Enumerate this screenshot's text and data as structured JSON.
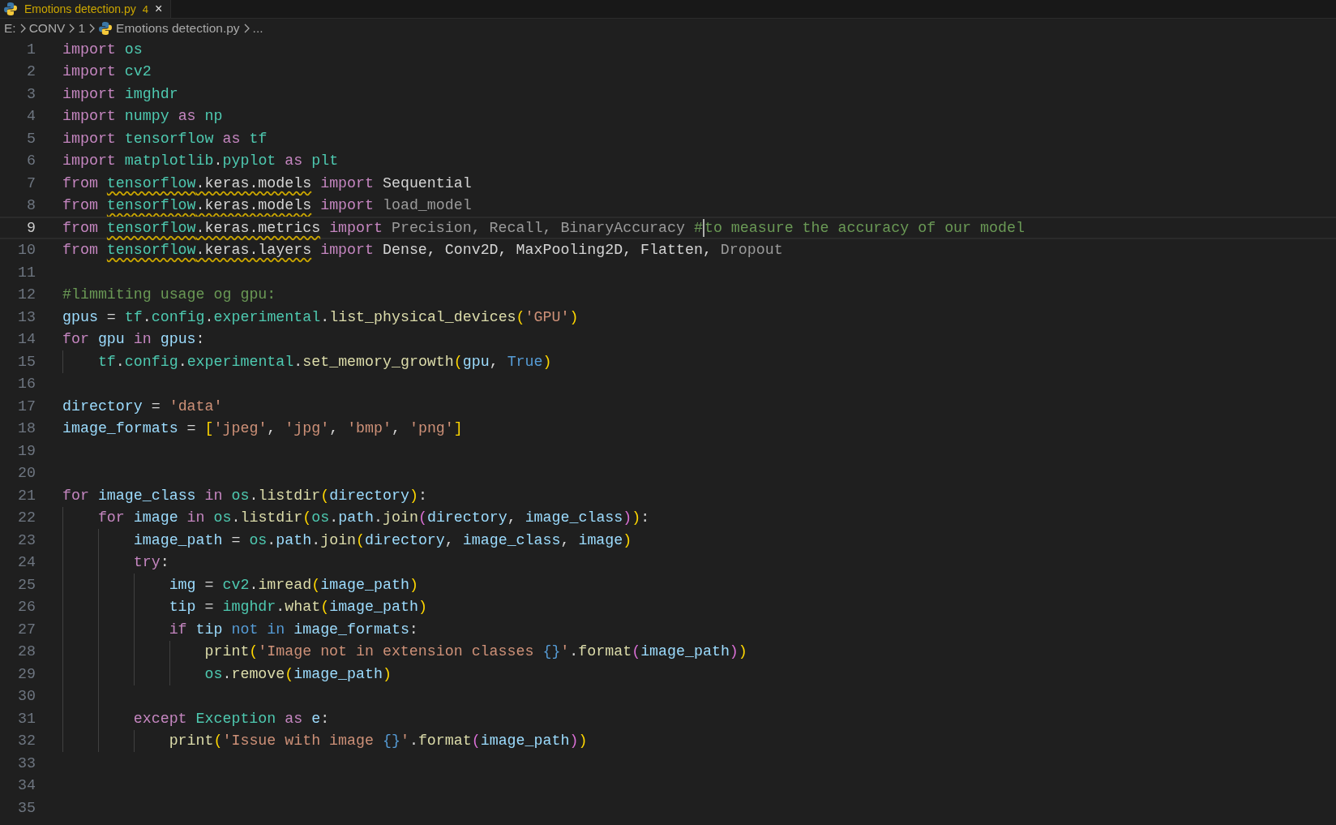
{
  "tab": {
    "title": "Emotions detection.py",
    "problems": "4",
    "close": "×"
  },
  "breadcrumb": [
    "E:",
    "CONV",
    "1",
    "Emotions detection.py",
    "..."
  ],
  "lines": [
    {
      "n": "1",
      "current": false,
      "tokens": [
        {
          "t": "import",
          "kind": "kw"
        },
        {
          "t": " os",
          "kind": "mod"
        }
      ]
    },
    {
      "n": "2",
      "current": false,
      "tokens": [
        {
          "t": "import",
          "kind": "kw"
        },
        {
          "t": " cv2",
          "kind": "mod"
        }
      ]
    },
    {
      "n": "3",
      "current": false,
      "tokens": [
        {
          "t": "import",
          "kind": "kw"
        },
        {
          "t": " imghdr",
          "kind": "mod"
        }
      ]
    },
    {
      "n": "4",
      "current": false,
      "tokens": [
        {
          "t": "import",
          "kind": "kw"
        },
        {
          "t": " numpy",
          "kind": "mod"
        },
        {
          "t": " as",
          "kind": "kw"
        },
        {
          "t": " np",
          "kind": "mod"
        }
      ]
    },
    {
      "n": "5",
      "current": false,
      "tokens": [
        {
          "t": "import",
          "kind": "kw"
        },
        {
          "t": " tensorflow",
          "kind": "mod"
        },
        {
          "t": " as",
          "kind": "kw"
        },
        {
          "t": " tf",
          "kind": "mod"
        }
      ]
    },
    {
      "n": "6",
      "current": false,
      "tokens": [
        {
          "t": "import",
          "kind": "kw"
        },
        {
          "t": " matplotlib",
          "kind": "mod"
        },
        {
          "t": ".",
          "kind": "plain"
        },
        {
          "t": "pyplot",
          "kind": "mod"
        },
        {
          "t": " as",
          "kind": "kw"
        },
        {
          "t": " plt",
          "kind": "mod"
        }
      ]
    },
    {
      "n": "7",
      "current": false,
      "tokens": [
        {
          "t": "from ",
          "kind": "kw"
        },
        {
          "t": "tensorflow",
          "kind": "mod",
          "warn": true
        },
        {
          "t": ".keras.models",
          "kind": "plain",
          "warn": true
        },
        {
          "t": " import",
          "kind": "kw"
        },
        {
          "t": " Sequential",
          "kind": "plain"
        }
      ]
    },
    {
      "n": "8",
      "current": false,
      "tokens": [
        {
          "t": "from ",
          "kind": "kw"
        },
        {
          "t": "tensorflow",
          "kind": "mod",
          "warn": true
        },
        {
          "t": ".keras.models",
          "kind": "plain",
          "warn": true
        },
        {
          "t": " import",
          "kind": "kw"
        },
        {
          "t": " load_model",
          "kind": "dim"
        }
      ]
    },
    {
      "n": "9",
      "current": true,
      "tokens": [
        {
          "t": "from ",
          "kind": "kw"
        },
        {
          "t": "tensorflow",
          "kind": "mod",
          "warn": true
        },
        {
          "t": ".keras.metrics",
          "kind": "plain",
          "warn": true
        },
        {
          "t": " import",
          "kind": "kw"
        },
        {
          "t": " Precision, Recall, BinaryAccuracy ",
          "kind": "dim"
        },
        {
          "t": "#",
          "kind": "cmt",
          "caret": true
        },
        {
          "t": "to measure the accuracy of our model",
          "kind": "cmt"
        }
      ]
    },
    {
      "n": "10",
      "current": false,
      "tokens": [
        {
          "t": "from ",
          "kind": "kw"
        },
        {
          "t": "tensorflow",
          "kind": "mod",
          "warn": true
        },
        {
          "t": ".keras.layers",
          "kind": "plain",
          "warn": true
        },
        {
          "t": " import",
          "kind": "kw"
        },
        {
          "t": " Dense, Conv2D, MaxPooling2D, Flatten,",
          "kind": "plain"
        },
        {
          "t": " Dropout",
          "kind": "dim"
        }
      ]
    },
    {
      "n": "11",
      "current": false
    },
    {
      "n": "12",
      "current": false,
      "tokens": [
        {
          "t": "#limmiting usage og gpu:",
          "kind": "cmt"
        }
      ]
    },
    {
      "n": "13",
      "current": false,
      "tokens": [
        {
          "t": "gpus",
          "kind": "var"
        },
        {
          "t": " = ",
          "kind": "plain"
        },
        {
          "t": "tf",
          "kind": "mod"
        },
        {
          "t": ".",
          "kind": "plain"
        },
        {
          "t": "config",
          "kind": "mod"
        },
        {
          "t": ".",
          "kind": "plain"
        },
        {
          "t": "experimental",
          "kind": "mod"
        },
        {
          "t": ".",
          "kind": "plain"
        },
        {
          "t": "list_physical_devices",
          "kind": "fn"
        },
        {
          "t": "(",
          "kind": "b1"
        },
        {
          "t": "'GPU'",
          "kind": "str"
        },
        {
          "t": ")",
          "kind": "b1"
        }
      ]
    },
    {
      "n": "14",
      "current": false,
      "tokens": [
        {
          "t": "for",
          "kind": "kw"
        },
        {
          "t": " gpu",
          "kind": "var"
        },
        {
          "t": " in",
          "kind": "kw"
        },
        {
          "t": " gpus",
          "kind": "var"
        },
        {
          "t": ":",
          "kind": "plain"
        }
      ]
    },
    {
      "n": "15",
      "current": false,
      "tokens": [
        {
          "t": "    tf",
          "kind": "mod"
        },
        {
          "t": ".",
          "kind": "plain"
        },
        {
          "t": "config",
          "kind": "mod"
        },
        {
          "t": ".",
          "kind": "plain"
        },
        {
          "t": "experimental",
          "kind": "mod"
        },
        {
          "t": ".",
          "kind": "plain"
        },
        {
          "t": "set_memory_growth",
          "kind": "fn"
        },
        {
          "t": "(",
          "kind": "b1"
        },
        {
          "t": "gpu",
          "kind": "var"
        },
        {
          "t": ", ",
          "kind": "plain"
        },
        {
          "t": "True",
          "kind": "const"
        },
        {
          "t": ")",
          "kind": "b1"
        }
      ]
    },
    {
      "n": "16",
      "current": false
    },
    {
      "n": "17",
      "current": false,
      "tokens": [
        {
          "t": "directory",
          "kind": "var"
        },
        {
          "t": " = ",
          "kind": "plain"
        },
        {
          "t": "'data'",
          "kind": "str"
        }
      ]
    },
    {
      "n": "18",
      "current": false,
      "tokens": [
        {
          "t": "image_formats",
          "kind": "var"
        },
        {
          "t": " = ",
          "kind": "plain"
        },
        {
          "t": "[",
          "kind": "b1"
        },
        {
          "t": "'jpeg'",
          "kind": "str"
        },
        {
          "t": ", ",
          "kind": "plain"
        },
        {
          "t": "'jpg'",
          "kind": "str"
        },
        {
          "t": ", ",
          "kind": "plain"
        },
        {
          "t": "'bmp'",
          "kind": "str"
        },
        {
          "t": ", ",
          "kind": "plain"
        },
        {
          "t": "'png'",
          "kind": "str"
        },
        {
          "t": "]",
          "kind": "b1"
        }
      ]
    },
    {
      "n": "19",
      "current": false
    },
    {
      "n": "20",
      "current": false
    },
    {
      "n": "21",
      "current": false,
      "tokens": [
        {
          "t": "for",
          "kind": "kw"
        },
        {
          "t": " image_class",
          "kind": "var"
        },
        {
          "t": " in",
          "kind": "kw"
        },
        {
          "t": " os",
          "kind": "mod"
        },
        {
          "t": ".",
          "kind": "plain"
        },
        {
          "t": "listdir",
          "kind": "fn"
        },
        {
          "t": "(",
          "kind": "b1"
        },
        {
          "t": "directory",
          "kind": "var"
        },
        {
          "t": ")",
          "kind": "b1"
        },
        {
          "t": ":",
          "kind": "plain"
        }
      ]
    },
    {
      "n": "22",
      "current": false,
      "tokens": [
        {
          "t": "    for",
          "kind": "kw"
        },
        {
          "t": " image",
          "kind": "var"
        },
        {
          "t": " in",
          "kind": "kw"
        },
        {
          "t": " os",
          "kind": "mod"
        },
        {
          "t": ".",
          "kind": "plain"
        },
        {
          "t": "listdir",
          "kind": "fn"
        },
        {
          "t": "(",
          "kind": "b1"
        },
        {
          "t": "os",
          "kind": "mod"
        },
        {
          "t": ".",
          "kind": "plain"
        },
        {
          "t": "path",
          "kind": "var"
        },
        {
          "t": ".",
          "kind": "plain"
        },
        {
          "t": "join",
          "kind": "fn"
        },
        {
          "t": "(",
          "kind": "b2"
        },
        {
          "t": "directory",
          "kind": "var"
        },
        {
          "t": ", ",
          "kind": "plain"
        },
        {
          "t": "image_class",
          "kind": "var"
        },
        {
          "t": ")",
          "kind": "b2"
        },
        {
          "t": ")",
          "kind": "b1"
        },
        {
          "t": ":",
          "kind": "plain"
        }
      ]
    },
    {
      "n": "23",
      "current": false,
      "tokens": [
        {
          "t": "        image_path",
          "kind": "var"
        },
        {
          "t": " = ",
          "kind": "plain"
        },
        {
          "t": "os",
          "kind": "mod"
        },
        {
          "t": ".",
          "kind": "plain"
        },
        {
          "t": "path",
          "kind": "var"
        },
        {
          "t": ".",
          "kind": "plain"
        },
        {
          "t": "join",
          "kind": "fn"
        },
        {
          "t": "(",
          "kind": "b1"
        },
        {
          "t": "directory",
          "kind": "var"
        },
        {
          "t": ", ",
          "kind": "plain"
        },
        {
          "t": "image_class",
          "kind": "var"
        },
        {
          "t": ", ",
          "kind": "plain"
        },
        {
          "t": "image",
          "kind": "var"
        },
        {
          "t": ")",
          "kind": "b1"
        }
      ]
    },
    {
      "n": "24",
      "current": false,
      "tokens": [
        {
          "t": "        try",
          "kind": "kw"
        },
        {
          "t": ":",
          "kind": "plain"
        }
      ]
    },
    {
      "n": "25",
      "current": false,
      "tokens": [
        {
          "t": "            img",
          "kind": "var"
        },
        {
          "t": " = ",
          "kind": "plain"
        },
        {
          "t": "cv2",
          "kind": "mod"
        },
        {
          "t": ".",
          "kind": "plain"
        },
        {
          "t": "imread",
          "kind": "fn"
        },
        {
          "t": "(",
          "kind": "b1"
        },
        {
          "t": "image_path",
          "kind": "var"
        },
        {
          "t": ")",
          "kind": "b1"
        }
      ]
    },
    {
      "n": "26",
      "current": false,
      "tokens": [
        {
          "t": "            tip",
          "kind": "var"
        },
        {
          "t": " = ",
          "kind": "plain"
        },
        {
          "t": "imghdr",
          "kind": "mod"
        },
        {
          "t": ".",
          "kind": "plain"
        },
        {
          "t": "what",
          "kind": "fn"
        },
        {
          "t": "(",
          "kind": "b1"
        },
        {
          "t": "image_path",
          "kind": "var"
        },
        {
          "t": ")",
          "kind": "b1"
        }
      ]
    },
    {
      "n": "27",
      "current": false,
      "tokens": [
        {
          "t": "            if",
          "kind": "kw"
        },
        {
          "t": " tip",
          "kind": "var"
        },
        {
          "t": " not in",
          "kind": "const"
        },
        {
          "t": " image_formats",
          "kind": "var"
        },
        {
          "t": ":",
          "kind": "plain"
        }
      ]
    },
    {
      "n": "28",
      "current": false,
      "tokens": [
        {
          "t": "                print",
          "kind": "fn"
        },
        {
          "t": "(",
          "kind": "b1"
        },
        {
          "t": "'Image not in extension classes ",
          "kind": "str"
        },
        {
          "t": "{}",
          "kind": "const"
        },
        {
          "t": "'",
          "kind": "str"
        },
        {
          "t": ".",
          "kind": "plain"
        },
        {
          "t": "format",
          "kind": "fn"
        },
        {
          "t": "(",
          "kind": "b2"
        },
        {
          "t": "image_path",
          "kind": "var"
        },
        {
          "t": ")",
          "kind": "b2"
        },
        {
          "t": ")",
          "kind": "b1"
        }
      ]
    },
    {
      "n": "29",
      "current": false,
      "tokens": [
        {
          "t": "                os",
          "kind": "mod"
        },
        {
          "t": ".",
          "kind": "plain"
        },
        {
          "t": "remove",
          "kind": "fn"
        },
        {
          "t": "(",
          "kind": "b1"
        },
        {
          "t": "image_path",
          "kind": "var"
        },
        {
          "t": ")",
          "kind": "b1"
        }
      ]
    },
    {
      "n": "30",
      "current": false
    },
    {
      "n": "31",
      "current": false,
      "tokens": [
        {
          "t": "        except",
          "kind": "kw"
        },
        {
          "t": " Exception",
          "kind": "mod"
        },
        {
          "t": " as",
          "kind": "kw"
        },
        {
          "t": " e",
          "kind": "var"
        },
        {
          "t": ":",
          "kind": "plain"
        }
      ]
    },
    {
      "n": "32",
      "current": false,
      "tokens": [
        {
          "t": "            print",
          "kind": "fn"
        },
        {
          "t": "(",
          "kind": "b1"
        },
        {
          "t": "'Issue with image ",
          "kind": "str"
        },
        {
          "t": "{}",
          "kind": "const"
        },
        {
          "t": "'",
          "kind": "str"
        },
        {
          "t": ".",
          "kind": "plain"
        },
        {
          "t": "format",
          "kind": "fn"
        },
        {
          "t": "(",
          "kind": "b2"
        },
        {
          "t": "image_path",
          "kind": "var"
        },
        {
          "t": ")",
          "kind": "b2"
        },
        {
          "t": ")",
          "kind": "b1"
        }
      ]
    },
    {
      "n": "33",
      "current": false
    },
    {
      "n": "34",
      "current": false
    },
    {
      "n": "35",
      "current": false
    }
  ]
}
